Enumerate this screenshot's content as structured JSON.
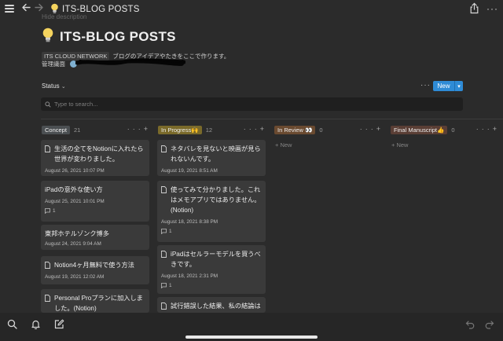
{
  "topbar": {
    "title": "ITS-BLOG POSTS",
    "icons": [
      "menu-icon",
      "back-arrow-icon",
      "forward-arrow-icon",
      "lightbulb-icon",
      "share-icon",
      "more-icon"
    ],
    "more": "···"
  },
  "page": {
    "faint_label": "Hide description",
    "title": "ITS-BLOG POSTS",
    "description_tag": "ITS CLOUD NETWORK",
    "description_text": "ブログのアイデアやたきをここで作ります。",
    "admin_label": "管理識面"
  },
  "toolbar": {
    "status_label": "Status",
    "more": "···",
    "new_label": "New",
    "search_placeholder": "Type to search..."
  },
  "columns": [
    {
      "name": "Concept",
      "count": "21",
      "pill_color": "#4b4f52",
      "cards": [
        {
          "title": "生活の全てをNotionに入れたら世界が変わりました。",
          "date": "August 26, 2021 10:07 PM",
          "comments": "",
          "doc": true
        },
        {
          "title": "iPadの意外な使い方",
          "date": "August 25, 2021 10:01 PM",
          "comments": "1",
          "doc": false
        },
        {
          "title": "東邦ホテルゾンク博多",
          "date": "August 24, 2021 9:04 AM",
          "comments": "",
          "doc": false
        },
        {
          "title": "Notion4ヶ月無料で使う方法",
          "date": "August 19, 2021 12:02 AM",
          "comments": "",
          "doc": true
        },
        {
          "title": "Personal Proプランに加入しました。(Notion)",
          "date": "",
          "comments": "",
          "doc": true
        }
      ]
    },
    {
      "name": "In Progress🙌",
      "count": "12",
      "pill_color": "#7a6a2a",
      "cards": [
        {
          "title": "ネタバレを見ないと映画が見られないんです。",
          "date": "August 19, 2021 8:51 AM",
          "comments": "",
          "doc": true
        },
        {
          "title": "使ってみて分かりました。これはメモアプリではありません。(Notion)",
          "date": "August 18, 2021 8:38 PM",
          "comments": "1",
          "doc": true
        },
        {
          "title": "iPadはセルラーモデルを買うべきです。",
          "date": "August 18, 2021 2:31 PM",
          "comments": "1",
          "doc": true
        },
        {
          "title": "試行錯誤した結果、私の結論は",
          "date": "",
          "comments": "",
          "doc": true
        }
      ]
    },
    {
      "name": "In Review 👀",
      "count": "0",
      "pill_color": "#6a4a30",
      "new_label": "New",
      "cards": []
    },
    {
      "name": "Final Manuscript👍",
      "count": "0",
      "pill_color": "#5a3e35",
      "new_label": "New",
      "cards": []
    }
  ],
  "colors": {
    "background": "#2b2b2b",
    "card": "#3a3a3a",
    "accent": "#2e8bd6"
  },
  "bottombar": {
    "icons": [
      "search-icon",
      "bell-icon",
      "compose-icon",
      "undo-icon",
      "redo-icon"
    ]
  }
}
